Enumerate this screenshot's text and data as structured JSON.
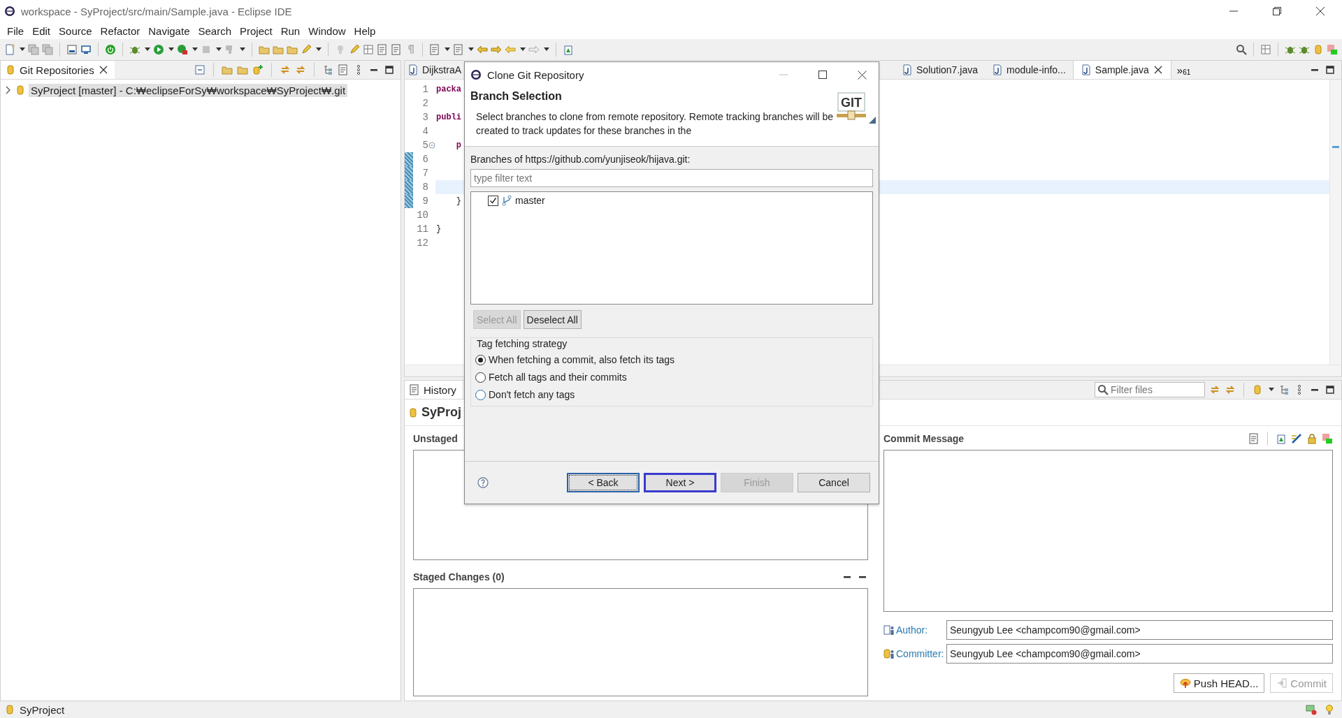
{
  "window": {
    "title": "workspace - SyProject/src/main/Sample.java - Eclipse IDE"
  },
  "menu": [
    "File",
    "Edit",
    "Source",
    "Refactor",
    "Navigate",
    "Search",
    "Project",
    "Run",
    "Window",
    "Help"
  ],
  "git_repositories": {
    "tab": "Git Repositories",
    "items": [
      {
        "label": "SyProject [master] - C:₩eclipseForSy₩workspace₩SyProject₩.git",
        "expanded": false,
        "selected": true
      }
    ]
  },
  "editor": {
    "tabs": [
      {
        "label": "DijkstraA",
        "selected": false
      },
      {
        "label": "Solution7.java",
        "selected": false
      },
      {
        "label": "module-info...",
        "selected": false
      },
      {
        "label": "Sample.java",
        "selected": true
      }
    ],
    "overflow": {
      "glyph": "»",
      "count": "61"
    },
    "lines": [
      {
        "number": "1",
        "text": "packa",
        "kind": "keyword",
        "current": false,
        "foldable": false,
        "changed": false
      },
      {
        "number": "2",
        "current": false,
        "foldable": false,
        "changed": false
      },
      {
        "number": "3",
        "text": "publi",
        "kind": "keyword",
        "current": false,
        "foldable": false,
        "changed": false
      },
      {
        "number": "4",
        "current": false,
        "foldable": false,
        "changed": false
      },
      {
        "number": "5",
        "text": "    p",
        "kind": "keyword",
        "current": false,
        "foldable": true,
        "changed": false
      },
      {
        "number": "6",
        "current": false,
        "foldable": false,
        "changed": true
      },
      {
        "number": "7",
        "current": false,
        "foldable": false,
        "changed": true
      },
      {
        "number": "8",
        "current": true,
        "foldable": false,
        "changed": true
      },
      {
        "number": "9",
        "text": "    }",
        "kind": "plain",
        "current": false,
        "foldable": false,
        "changed": true
      },
      {
        "number": "10",
        "current": false,
        "foldable": false,
        "changed": false
      },
      {
        "number": "11",
        "text": "}",
        "kind": "plain",
        "current": false,
        "foldable": false,
        "changed": false
      },
      {
        "number": "12",
        "current": false,
        "foldable": false,
        "changed": false
      }
    ]
  },
  "staging": {
    "tab": "History",
    "filter_placeholder": "Filter files",
    "repository": "SyProj",
    "unstaged_label": "Unstaged",
    "staged_label": "Staged Changes (0)",
    "commit_label": "Commit Message",
    "author_label": "Author:",
    "author": "Seungyub Lee <champcom90@gmail.com>",
    "committer_label": "Committer:",
    "committer": "Seungyub Lee <champcom90@gmail.com>",
    "buttons": [
      {
        "label": "Push HEAD...",
        "disabled": false
      },
      {
        "label": "Commit",
        "disabled": true
      }
    ]
  },
  "dialog": {
    "title": "Clone Git Repository",
    "heading": "Branch Selection",
    "description": "Select branches to clone from remote repository. Remote tracking branches will be created to track updates for these branches in the",
    "logo_text": "GIT",
    "branches_label": "Branches of https://github.com/yunjiseok/hijava.git:",
    "filter_placeholder": "type filter text",
    "branches": [
      {
        "name": "master",
        "checked": true
      }
    ],
    "selection_buttons": [
      {
        "label": "Select All",
        "disabled": true
      },
      {
        "label": "Deselect All",
        "disabled": false
      }
    ],
    "tag_group": {
      "title": "Tag fetching strategy",
      "options": [
        {
          "label": "When fetching a commit, also fetch its tags",
          "selected": true
        },
        {
          "label": "Fetch all tags and their commits",
          "selected": false
        },
        {
          "label": "Don't fetch any tags",
          "selected": false
        }
      ]
    },
    "buttons": [
      {
        "label": "< Back",
        "disabled": false,
        "focused": true,
        "default": false
      },
      {
        "label": "Next >",
        "disabled": false,
        "focused": false,
        "default": true
      },
      {
        "label": "Finish",
        "disabled": true,
        "focused": false,
        "default": false
      },
      {
        "label": "Cancel",
        "disabled": false,
        "focused": false,
        "default": false
      }
    ]
  },
  "status_bar": {
    "text": "SyProject"
  }
}
